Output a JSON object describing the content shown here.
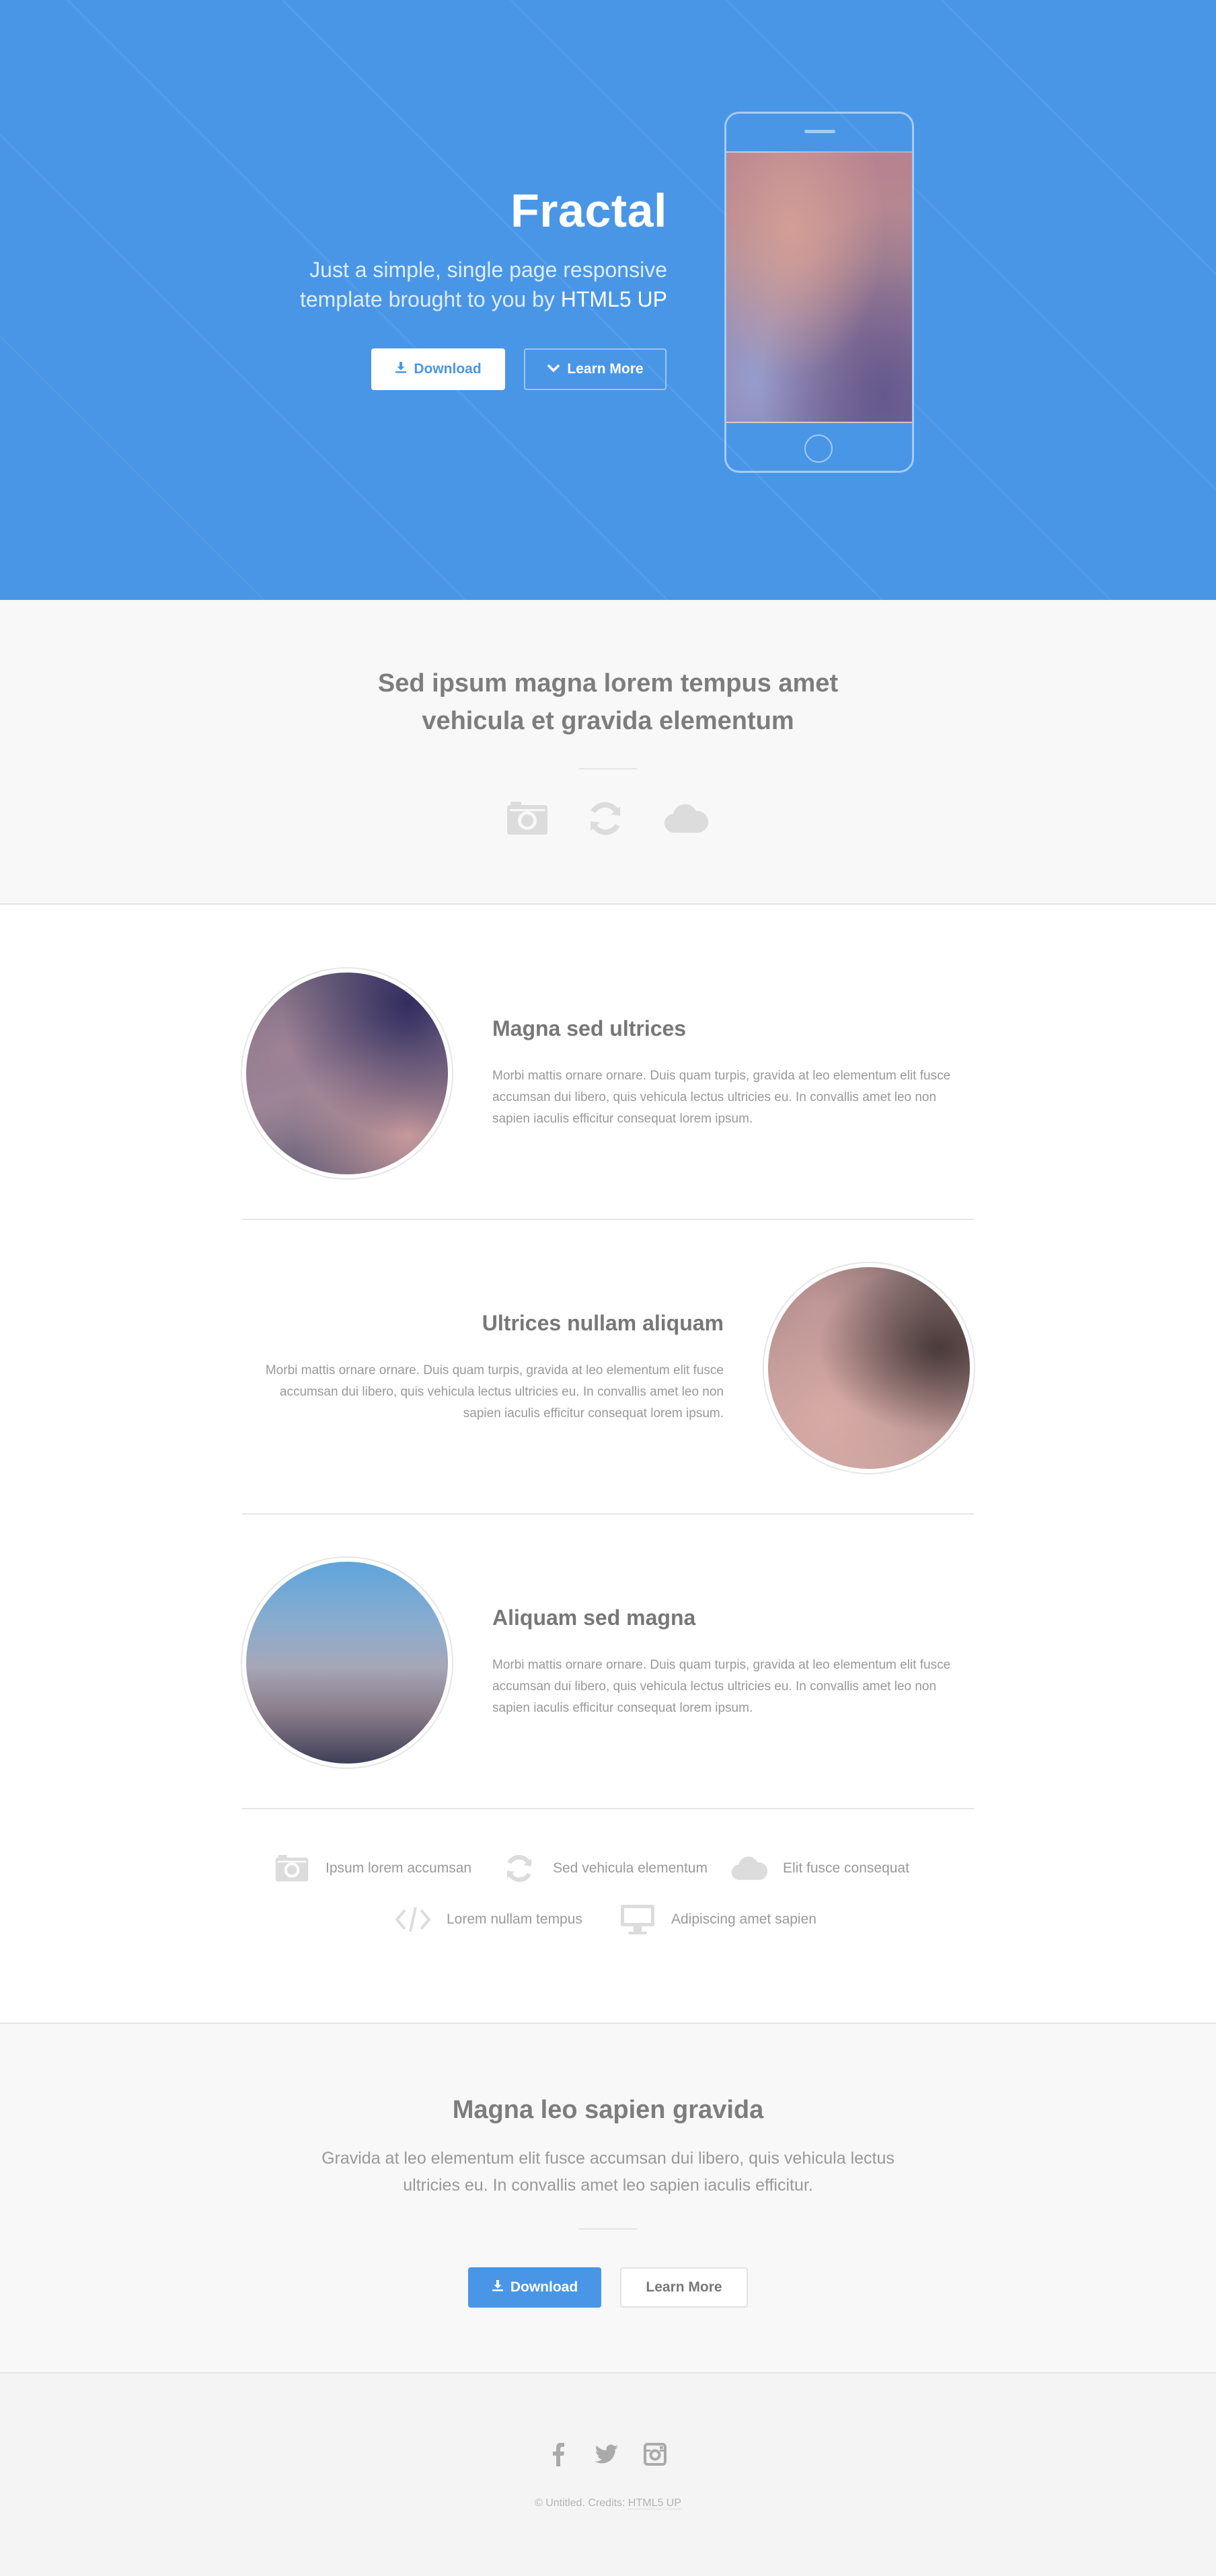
{
  "header": {
    "title": "Fractal",
    "subtitle_prefix": "Just a simple, single page responsive",
    "subtitle_line2_prefix": "template brought to you by",
    "subtitle_link": "HTML5 UP",
    "download_label": "Download",
    "learn_more_label": "Learn More",
    "accent_color": "#4a96e6"
  },
  "intro": {
    "heading_line1": "Sed ipsum magna lorem tempus amet",
    "heading_line2": "vehicula et gravida elementum",
    "icons": [
      "camera-icon",
      "refresh-icon",
      "cloud-icon"
    ]
  },
  "spotlights": [
    {
      "title": "Magna sed ultrices",
      "body": "Morbi mattis ornare ornare. Duis quam turpis, gravida at leo elementum elit fusce accumsan dui libero, quis vehicula lectus ultricies eu. In convallis amet leo non sapien iaculis efficitur consequat lorem ipsum."
    },
    {
      "title": "Ultrices nullam aliquam",
      "body": "Morbi mattis ornare ornare. Duis quam turpis, gravida at leo elementum elit fusce accumsan dui libero, quis vehicula lectus ultricies eu. In convallis amet leo non sapien iaculis efficitur consequat lorem ipsum."
    },
    {
      "title": "Aliquam sed magna",
      "body": "Morbi mattis ornare ornare. Duis quam turpis, gravida at leo elementum elit fusce accumsan dui libero, quis vehicula lectus ultricies eu. In convallis amet leo non sapien iaculis efficitur consequat lorem ipsum."
    }
  ],
  "features": [
    {
      "icon": "camera-icon",
      "label": "Ipsum lorem accumsan"
    },
    {
      "icon": "refresh-icon",
      "label": "Sed vehicula elementum"
    },
    {
      "icon": "cloud-icon",
      "label": "Elit fusce consequat"
    },
    {
      "icon": "code-icon",
      "label": "Lorem nullam tempus"
    },
    {
      "icon": "desktop-icon",
      "label": "Adipiscing amet sapien"
    }
  ],
  "cta": {
    "title": "Magna leo sapien gravida",
    "body": "Gravida at leo elementum elit fusce accumsan dui libero, quis vehicula lectus ultricies eu. In convallis amet leo sapien iaculis efficitur.",
    "download_label": "Download",
    "learn_more_label": "Learn More"
  },
  "footer": {
    "social": [
      "facebook-icon",
      "twitter-icon",
      "instagram-icon"
    ],
    "copyright_prefix": "© Untitled. Credits:",
    "credit_link": "HTML5 UP"
  }
}
